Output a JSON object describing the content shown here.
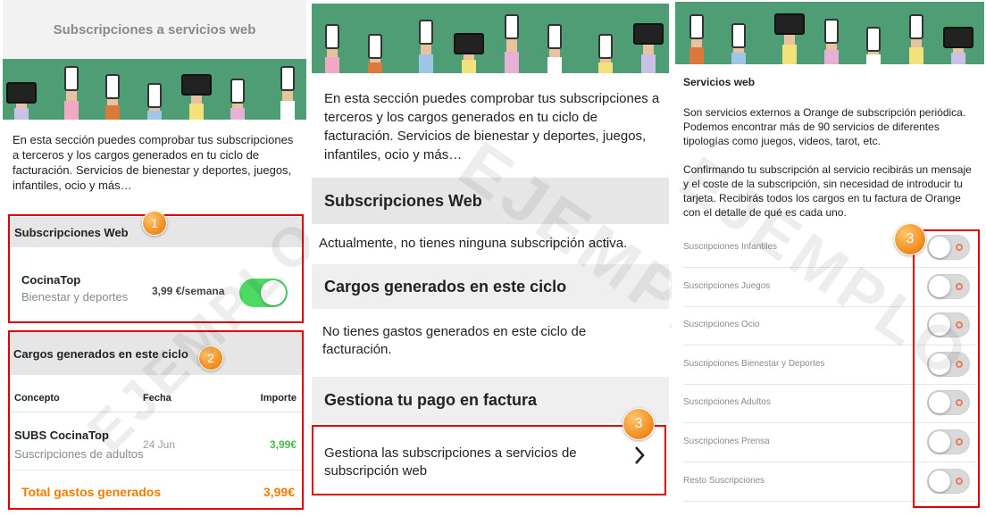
{
  "panel1": {
    "header_title": "Subscripciones a servicios web",
    "intro": "En esta sección puedes comprobar tus subscripciones a terceros y los cargos generados en tu ciclo de facturación. Servicios de bienestar y deportes, juegos, infantiles, ocio y más…",
    "subs_section": {
      "title": "Subscripciones Web",
      "badge": "1",
      "item": {
        "name": "CocinaTop",
        "category": "Bienestar y deportes",
        "price": "3,99 €/semana",
        "enabled": true
      }
    },
    "charges_section": {
      "title": "Cargos generados en este ciclo",
      "badge": "2",
      "columns": {
        "concept": "Concepto",
        "date": "Fecha",
        "amount": "Importe"
      },
      "row": {
        "concept": "SUBS CocinaTop",
        "sub": "Suscripciones de adultos",
        "date": "24 Jun",
        "amount": "3,99€"
      },
      "total_label": "Total gastos generados",
      "total_value": "3,99€"
    },
    "watermark": "EJEMPLO"
  },
  "panel2": {
    "intro": "En esta sección puedes comprobar tus subscripciones a terceros y los cargos generados en tu ciclo de facturación. Servicios de bienestar y deportes, juegos, infantiles, ocio y más…",
    "subs_title": "Subscripciones Web",
    "subs_empty": "Actualmente, no tienes ninguna subscripción activa.",
    "charges_title": "Cargos generados en este ciclo",
    "charges_empty": "No tienes gastos generados en este ciclo de facturación.",
    "payment_title": "Gestiona tu pago en factura",
    "manage_link": "Gestiona las subscripciones a servicios de subscripción web",
    "badge": "3",
    "watermark": "EJEMPLO"
  },
  "panel3": {
    "title": "Servicios web",
    "para1": "Son servicios externos a Orange de subscripción periódica. Podemos encontrar más de 90 servicios de diferentes tipologías como juegos, videos, tarot, etc.",
    "para2": "Confirmando tu subscripción al servicio recibirás un mensaje y el coste de la subscripción, sin necesidad de introducir tu tarjeta. Recibirás todos los cargos en tu factura de Orange con el detalle de qué es cada uno.",
    "badge": "3",
    "items": [
      {
        "label": "Suscripciones Infantiles",
        "enabled": false
      },
      {
        "label": "Suscripciones Juegos",
        "enabled": false
      },
      {
        "label": "Suscripciones Ocio",
        "enabled": false
      },
      {
        "label": "Suscripciones Bienestar y Deportes",
        "enabled": false
      },
      {
        "label": "Suscripciones Adultos",
        "enabled": false
      },
      {
        "label": "Suscripciones Prensa",
        "enabled": false
      },
      {
        "label": "Resto Suscripciones",
        "enabled": false
      }
    ],
    "watermark": "EJEMPLO"
  },
  "colors": {
    "banner_green": "#4e9d74",
    "highlight_red": "#e10000",
    "toggle_green": "#4cd964",
    "amount_green": "#4cb84c",
    "total_orange": "#f07d00",
    "badge_orange": "#f08a1c"
  }
}
